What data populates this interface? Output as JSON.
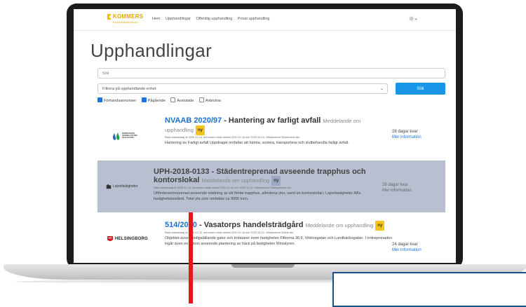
{
  "nav": {
    "logo_text": "KOMMERS",
    "logo_subtext": "Kommersannons.se",
    "links": [
      "Hem",
      "Upphandlingar",
      "Offentlig upphandling",
      "Privat upphandling"
    ],
    "user_icon": "gear-icon",
    "user_caret": "▾"
  },
  "page": {
    "title": "Upphandlingar"
  },
  "search": {
    "placeholder": "Sök",
    "filter_label": "Filtrera på upphandlande enhet",
    "button_label": "Sök"
  },
  "filters": [
    {
      "label": "Förhandsannonser",
      "checked": true
    },
    {
      "label": "Pågående",
      "checked": true
    },
    {
      "label": "Avslutade",
      "checked": false
    },
    {
      "label": "Avbrutna",
      "checked": false
    }
  ],
  "results": [
    {
      "id": "NVAAB 2020/97",
      "title": "Hantering av farligt avfall",
      "type": "Meddelande om upphandling",
      "badge": "ny",
      "org": "NORDVÄSTRA SKÅNES VATTEN OCH AVLOPP",
      "meta": "Sista anbudsdag är 2020-12-14, annonsen visas mellan 2020-11-16 och 2020-12-14. Utförandeort Stockholms län.",
      "desc": "Hantering av Farligt avfall Uppdraget omfattar att hämta, sortera, transportera och slutbehandla farligt avfall.",
      "days_left": "28 dagar kvar",
      "more": "Mer information"
    },
    {
      "id": "UPH-2018-0133",
      "title": "Städentreprenad avseende trapphus och kontorslokal",
      "type": "Meddelande om upphandling",
      "badge": "ny",
      "org": "Lejonfastigheter",
      "meta": "Sista anbudsdag är 2020-12-14, annonsen visas mellan 2020-11-16 och 2020-12-14. Utförandeort Östergötlands län.",
      "desc": "Utfördenentreprenad avseende städning av ett flertal trapphus, allmänna ytor, samt en kontorslokal i Lejonfastigheter ABs fastighetsbestånd. Total yta som omfattas ca 9000 kvm.",
      "days_left": "28 dagar kvar",
      "more": "Mer information"
    },
    {
      "id": "514/2020",
      "title": "Vasatorps handelsträdgård",
      "type": "Meddelande om upphandling",
      "badge": "ny",
      "org": "HELSINGBORG",
      "meta": "Sista anbudsdag är 2020-12-10, annonsen visas mellan 2020-11-16 och 2020-12-10. Utförandeort Skåne län.",
      "desc": "Objektet avser färdigställande gator och trottoarer inom fastigheten Filborna 36:9, Vildrosgatan och Lundbäcksgatan. I entreprenaden ingår även en option avseende plantering av häck på fastigheten Miniatyren.",
      "days_left": "24 dagar kvar",
      "more": "Mer information"
    }
  ],
  "colors": {
    "accent": "#1a96e8",
    "link": "#1a6fd0",
    "badge": "#f5c518",
    "highlight_row": "#b8bfd1",
    "annotation_line": "#e8141e",
    "annotation_box": "#1a4f8a"
  }
}
